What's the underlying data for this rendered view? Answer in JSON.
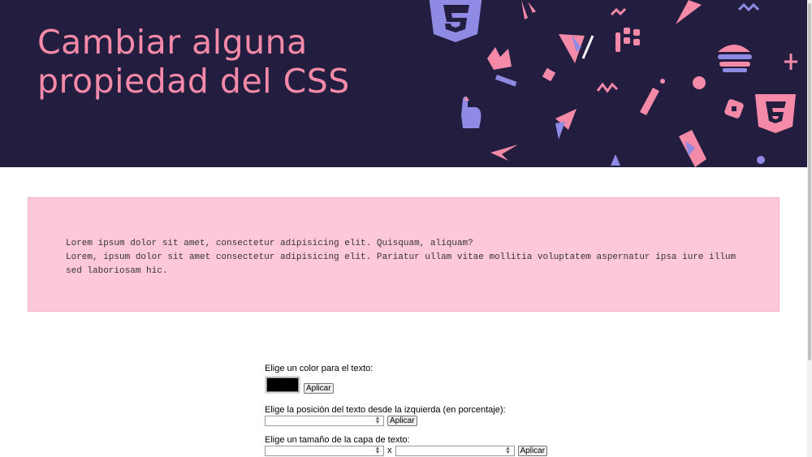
{
  "header": {
    "title_line1": "Cambiar alguna",
    "title_line2": "propiedad del CSS",
    "background_color": "#231d40",
    "title_color": "#f48aa8",
    "decoration_icons": [
      "css3-shield-icon",
      "pointer-hand-icon",
      "lightbulb-icon",
      "grid-icon",
      "paper-plane-icon",
      "pen-nib-icon",
      "burger-icon",
      "pencil-icon",
      "css3-shield-icon"
    ]
  },
  "text_box": {
    "line1": "Lorem ipsum dolor sit amet, consectetur adipisicing elit. Quisquam, aliquam?",
    "line2": "Lorem, ipsum dolor sit amet consectetur adipisicing elit. Pariatur ullam vitae mollitia voluptatem aspernatur ipsa iure illum sed laboriosam hic.",
    "background_color": "#fec8db"
  },
  "controls": {
    "color_label": "Elige un color para el texto:",
    "color_value": "#000000",
    "position_label": "Elige la posición del texto desde la izquierda (en porcentaje):",
    "position_value": "",
    "size_label": "Elige un tamaño de la capa de texto:",
    "width_value": "",
    "height_value": "",
    "separator": "x",
    "apply_label": "Aplicar"
  }
}
